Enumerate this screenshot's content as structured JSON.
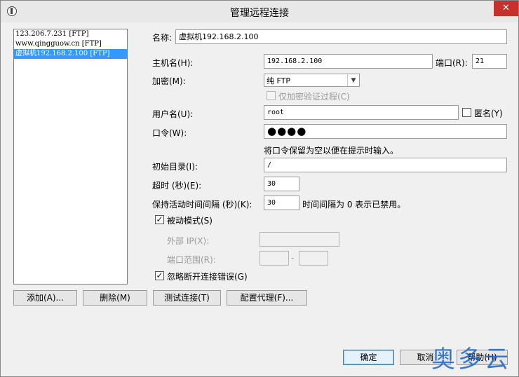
{
  "window": {
    "title": "管理远程连接",
    "close_glyph": "✕"
  },
  "connections": [
    {
      "label": "123.206.7.231 [FTP]",
      "selected": false
    },
    {
      "label": "www.qingguow.cn [FTP]",
      "selected": false
    },
    {
      "label": "虚拟机192.168.2.100 [FTP]",
      "selected": true
    }
  ],
  "form": {
    "name_label": "名称:",
    "name_value": "虚拟机192.168.2.100",
    "host_label": "主机名(H):",
    "host_value": "192.168.2.100",
    "port_label": "端口(R):",
    "port_value": "21",
    "encryption_label": "加密(M):",
    "encryption_value": "纯 FTP",
    "encrypt_auth_only_label": "仅加密验证过程(C)",
    "username_label": "用户名(U):",
    "username_value": "root",
    "anonymous_label": "匿名(Y)",
    "password_label": "口令(W):",
    "password_value": "●●●●",
    "password_hint": "将口令保留为空以便在提示时输入。",
    "initial_dir_label": "初始目录(I):",
    "initial_dir_value": "/",
    "timeout_label": "超时 (秒)(E):",
    "timeout_value": "30",
    "keepalive_label": "保持活动时间间隔 (秒)(K):",
    "keepalive_value": "30",
    "keepalive_hint": "时间间隔为 0 表示已禁用。",
    "passive_mode_label": "被动模式(S)",
    "passive_mode_checked": true,
    "external_ip_label": "外部 IP(X):",
    "external_ip_value": "",
    "port_range_label": "端口范围(R):",
    "port_range_from": "",
    "port_range_sep": "-",
    "port_range_to": "",
    "ignore_errors_label": "忽略断开连接错误(G)",
    "ignore_errors_checked": true,
    "check_mark": "✓"
  },
  "buttons": {
    "add": "添加(A)...",
    "delete": "删除(M)",
    "test": "测试连接(T)",
    "proxy": "配置代理(F)...",
    "ok": "确定",
    "cancel": "取消",
    "help": "帮助(H)"
  },
  "watermark": "奥多云",
  "colors": {
    "selection": "#3399ff",
    "close": "#c7302b",
    "watermark": "#1b66c9"
  }
}
